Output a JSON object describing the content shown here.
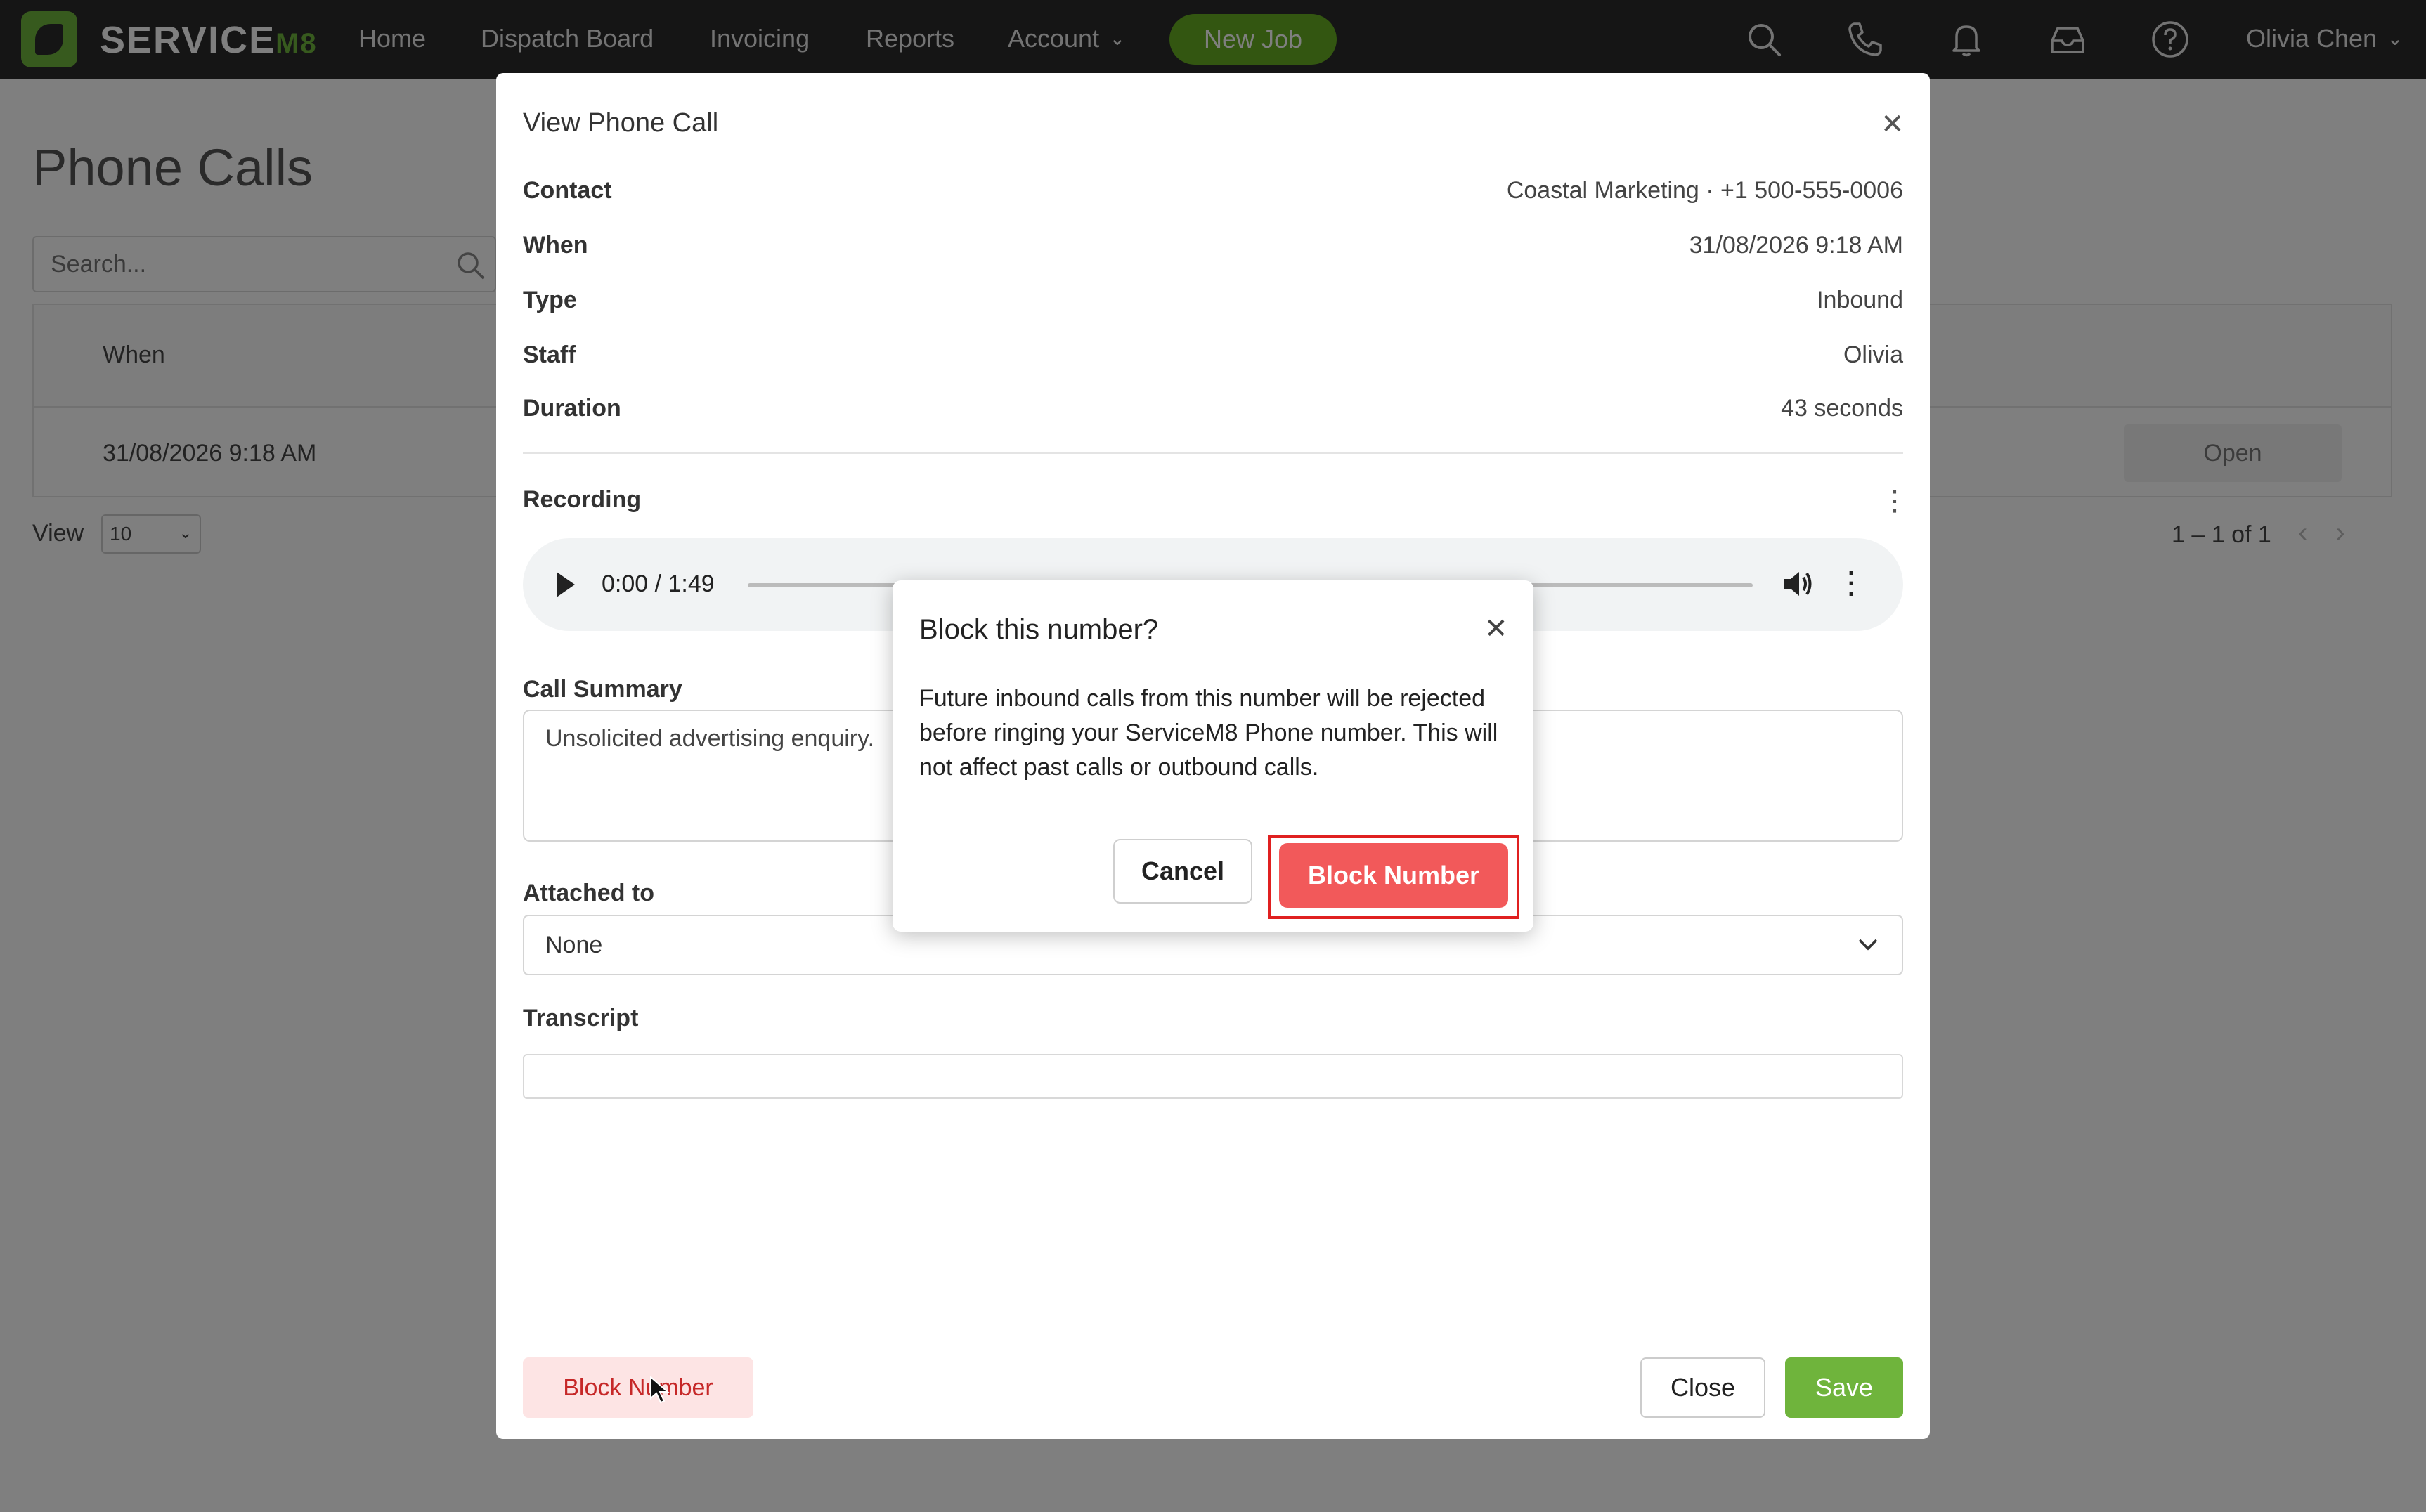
{
  "app": {
    "brand": "SERVICE",
    "brand_suffix": "M8"
  },
  "nav": {
    "items": [
      "Home",
      "Dispatch Board",
      "Invoicing",
      "Reports",
      "Account"
    ],
    "new_job": "New Job",
    "user": "Olivia Chen",
    "icons": [
      "search-icon",
      "phone-icon",
      "bell-icon",
      "inbox-icon",
      "help-icon"
    ]
  },
  "page": {
    "title": "Phone Calls",
    "search_placeholder": "Search...",
    "table": {
      "columns": [
        "When"
      ],
      "rows": [
        {
          "when": "31/08/2026 9:18 AM",
          "action": "Open"
        }
      ]
    },
    "view_label": "View",
    "view_value": "10",
    "pager": "1 – 1 of 1"
  },
  "modal": {
    "title": "View Phone Call",
    "fields": [
      {
        "label": "Contact",
        "value": "Coastal Marketing · +1 500-555-0006"
      },
      {
        "label": "When",
        "value": "31/08/2026 9:18 AM"
      },
      {
        "label": "Type",
        "value": "Inbound"
      },
      {
        "label": "Staff",
        "value": "Olivia"
      },
      {
        "label": "Duration",
        "value": "43 seconds"
      }
    ],
    "recording_label": "Recording",
    "audio_time": "0:00 / 1:49",
    "summary_label": "Call Summary",
    "summary_value": "Unsolicited advertising enquiry.",
    "attached_label": "Attached to",
    "attached_value": "None",
    "transcript_label": "Transcript",
    "block_button": "Block Number",
    "close_button": "Close",
    "save_button": "Save"
  },
  "confirm": {
    "title": "Block this number?",
    "body": "Future inbound calls from this number will be rejected before ringing your ServiceM8 Phone number. This will not affect past calls or outbound calls.",
    "cancel": "Cancel",
    "confirm": "Block Number"
  },
  "colors": {
    "brand_green": "#6fb43c",
    "danger": "#f2595a",
    "highlight": "#e02020",
    "topbar": "#2b2b2b"
  }
}
